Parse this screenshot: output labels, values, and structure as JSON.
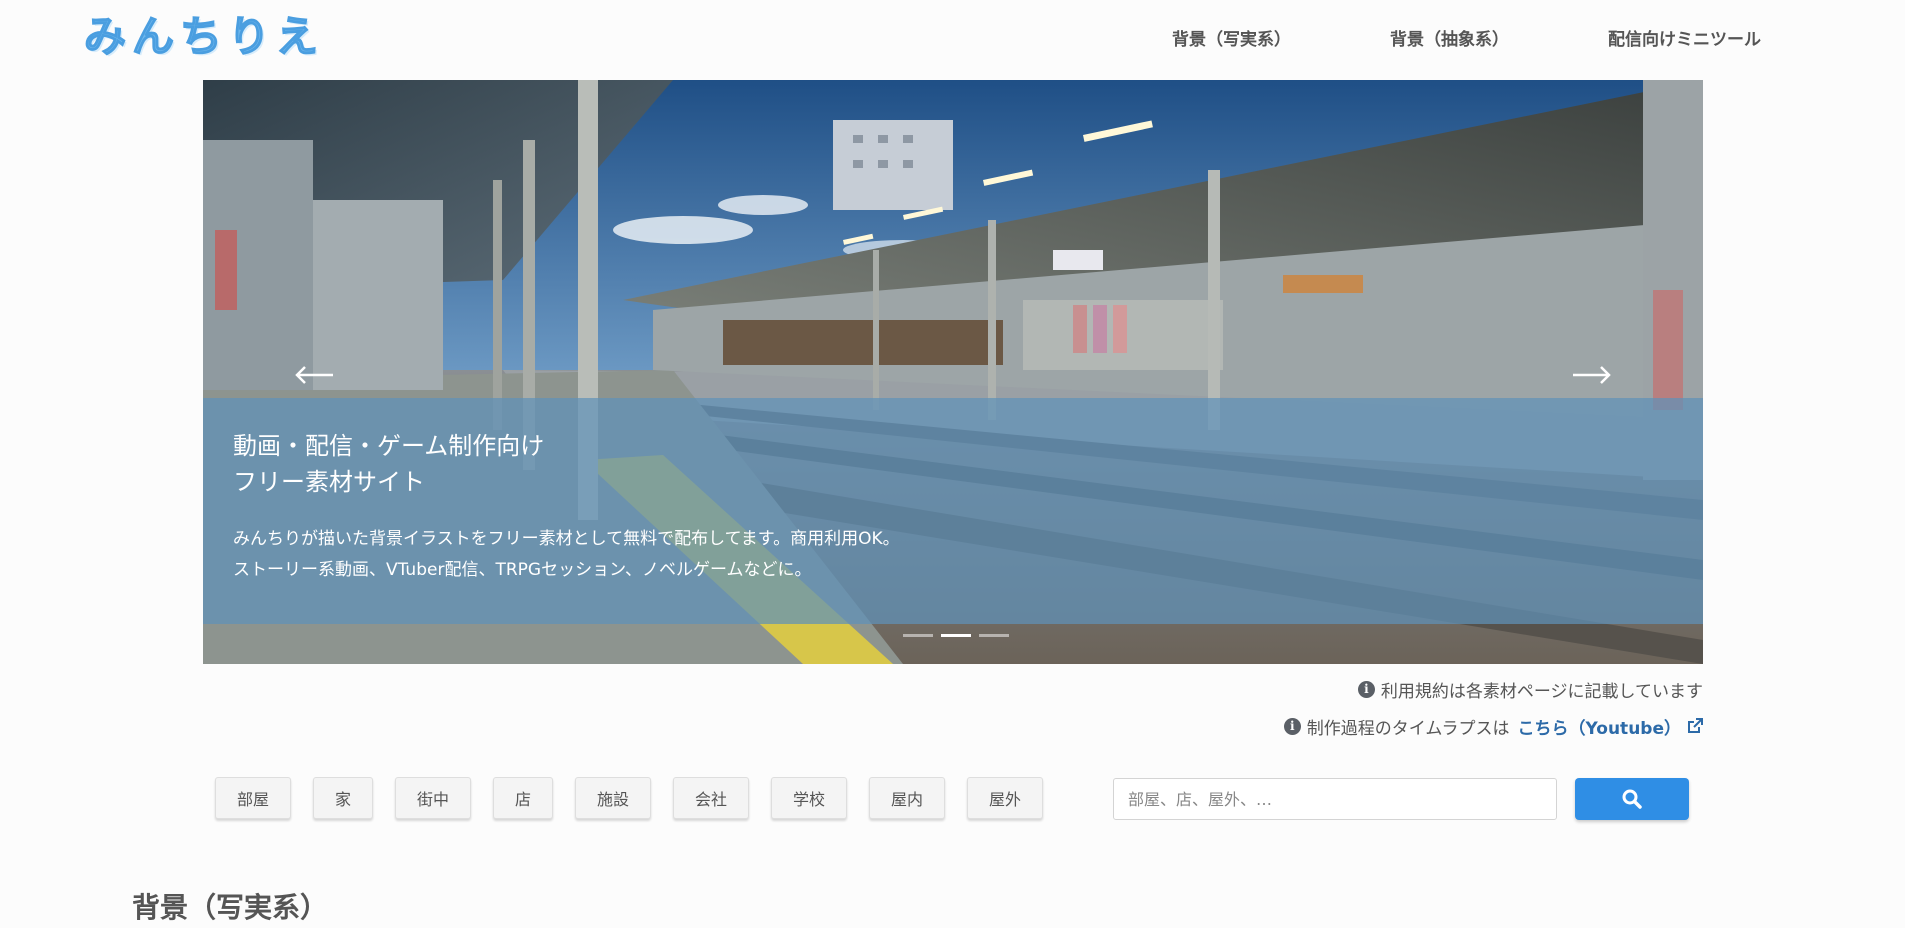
{
  "site": {
    "logo_text": "みんちりえ"
  },
  "nav": {
    "items": [
      {
        "label": "背景（写実系）"
      },
      {
        "label": "背景（抽象系）"
      },
      {
        "label": "配信向けミニツール"
      }
    ]
  },
  "hero": {
    "title_line1": "動画・配信・ゲーム制作向け",
    "title_line2": "フリー素材サイト",
    "desc_line1": "みんちりが描いた背景イラストをフリー素材として無料で配布してます。商用利用OK。",
    "desc_line2": "ストーリー系動画、VTuber配信、TRPGセッション、ノベルゲームなどに。",
    "prev_icon": "chevron-left-icon",
    "next_icon": "chevron-right-icon",
    "slide_count": 3,
    "active_slide": 2
  },
  "notes": {
    "terms": "利用規約は各素材ページに記載しています",
    "timelapse_prefix": "制作過程のタイムラプスは",
    "timelapse_link": "こちら（Youtube）"
  },
  "categories": [
    "部屋",
    "家",
    "街中",
    "店",
    "施設",
    "会社",
    "学校",
    "屋内",
    "屋外"
  ],
  "search": {
    "placeholder": "部屋、店、屋外、…",
    "value": "",
    "button_icon": "search-icon"
  },
  "section": {
    "heading": "背景（写実系）"
  },
  "colors": {
    "accent": "#2f8ee5",
    "logo": "#6fb7ec",
    "caption_bg": "#5f91b9",
    "link": "#2c6aa8"
  }
}
